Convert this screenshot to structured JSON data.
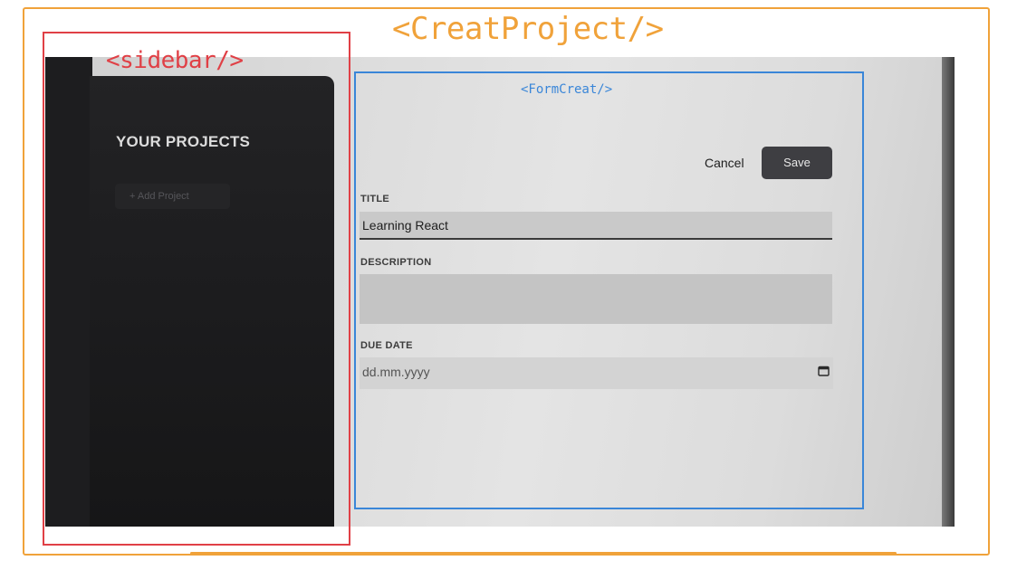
{
  "annotations": {
    "outer_label": "<CreatProject/>",
    "sidebar_label": "<sidebar/>",
    "form_label": "<FormCreat/>",
    "outer_color": "#f0a23a",
    "sidebar_color": "#e04046",
    "form_color": "#3a86d8"
  },
  "sidebar": {
    "heading": "YOUR PROJECTS",
    "add_button_label": "+ Add Project"
  },
  "form": {
    "cancel_label": "Cancel",
    "save_label": "Save",
    "title_label": "TITLE",
    "title_value": "Learning React",
    "description_label": "DESCRIPTION",
    "description_value": "",
    "due_date_label": "DUE DATE",
    "due_date_placeholder": "dd.mm.yyyy",
    "calendar_icon": "calendar-icon"
  }
}
